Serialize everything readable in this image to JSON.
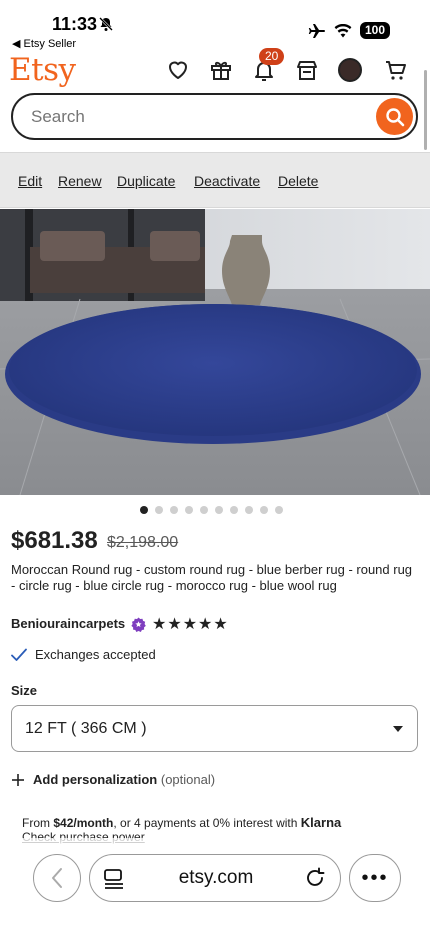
{
  "status_bar": {
    "time": "11:33",
    "back_label": "◀ Etsy Seller",
    "battery": "100"
  },
  "header": {
    "logo": "Etsy",
    "notification_count": "20",
    "icons": [
      "heart-icon",
      "gift-icon",
      "bell-icon",
      "store-icon",
      "avatar",
      "cart-icon"
    ]
  },
  "search": {
    "placeholder": "Search"
  },
  "seller_actions": [
    "Edit",
    "Renew",
    "Duplicate",
    "Deactivate",
    "Delete"
  ],
  "gallery": {
    "image_count": 10,
    "active_index": 0
  },
  "product": {
    "price": "$681.38",
    "original_price": "$2,198.00",
    "title": "Moroccan Round rug - custom round rug - blue berber rug - round rug - circle rug - blue circle rug - morocco rug - blue wool rug",
    "shop_name": "Beniouraincarpets",
    "rating": 5,
    "stars": "★★★★★",
    "exchanges": "Exchanges accepted"
  },
  "size": {
    "label": "Size",
    "selected": "12 FT ( 366 CM )"
  },
  "personalization": {
    "label": "Add personalization",
    "optional": "(optional)"
  },
  "klarna": {
    "prefix": "From ",
    "monthly": "$42/month",
    "middle": ", or 4 payments at 0% interest with ",
    "brand": "Klarna",
    "link": "Check purchase power"
  },
  "browser": {
    "url": "etsy.com",
    "more": "•••"
  },
  "colors": {
    "brand_orange": "#f1641e",
    "badge": "#cf4018",
    "rug_blue": "#2d3f8a",
    "check_blue": "#2b5db8"
  }
}
